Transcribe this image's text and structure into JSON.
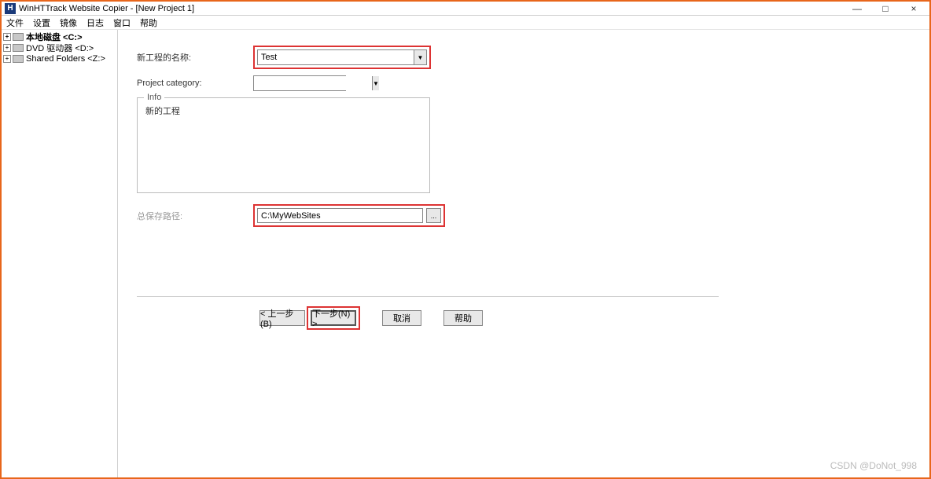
{
  "window": {
    "title": "WinHTTrack Website Copier - [New Project 1]",
    "controls": {
      "min": "—",
      "max": "□",
      "close": "×"
    }
  },
  "menu": [
    "文件",
    "设置",
    "镜像",
    "日志",
    "窗口",
    "帮助"
  ],
  "tree": {
    "items": [
      {
        "label": "本地磁盘 <C:>",
        "bold": true
      },
      {
        "label": "DVD 驱动器 <D:>",
        "bold": false
      },
      {
        "label": "Shared Folders <Z:>",
        "bold": false
      }
    ]
  },
  "form": {
    "project_name_label": "新工程的名称:",
    "project_name_value": "Test",
    "category_label": "Project category:",
    "category_value": "",
    "info_legend": "Info",
    "info_text": "新的工程",
    "base_path_label": "总保存路径:",
    "base_path_value": "C:\\MyWebSites",
    "browse_label": "..."
  },
  "buttons": {
    "back": "< 上一步(B)",
    "next": "下一步(N) >",
    "cancel": "取消",
    "help": "帮助"
  },
  "watermark": "CSDN @DoNot_998"
}
